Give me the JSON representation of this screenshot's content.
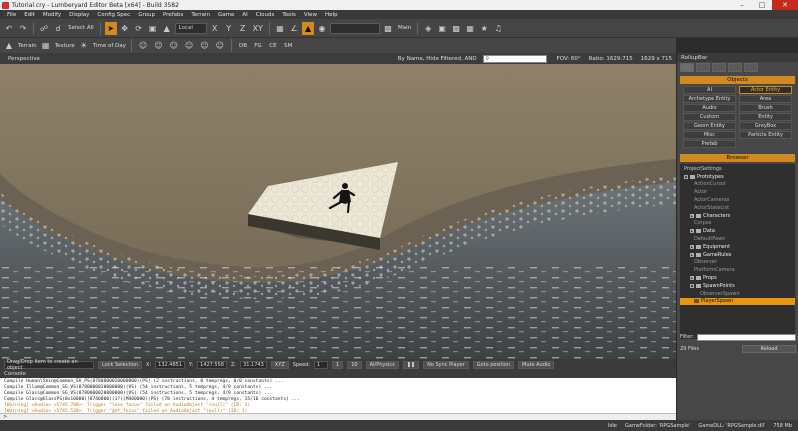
{
  "title": "Tutorial.cry - Lumberyard Editor Beta [x64] - Build 3582",
  "menu": [
    "File",
    "Edit",
    "Modify",
    "Display",
    "Config Spec",
    "Group",
    "Prefabs",
    "Terrain",
    "Game",
    "AI",
    "Clouds",
    "Tools",
    "View",
    "Help"
  ],
  "toolbar": {
    "select_all": "Select All",
    "coord_system": "Local",
    "axes": [
      "X",
      "Y",
      "Z",
      "XY"
    ],
    "main_label": "Main"
  },
  "toolbar2": {
    "terrain": "Terrain",
    "texture": "Texture",
    "time_of_day": "Time of Day",
    "codes": [
      "DB",
      "FG",
      "CE",
      "SM"
    ]
  },
  "viewport": {
    "name": "Perspective",
    "filter": "By Name, Hide Filtered, AND",
    "fov_label": "FOV:",
    "fov": "60°",
    "ratio_label": "Ratio:",
    "ratio": "1629:715",
    "resolution": "1629 x 715"
  },
  "statusbar": {
    "hint": "Drag/Drop item to create an object",
    "lock_selection": "Lock Selection",
    "x_label": "X:",
    "x": "132.4851",
    "y_label": "Y:",
    "y": "1427.558",
    "z_label": "Z:",
    "z": "31.1743",
    "xyz_label": "XYZ",
    "speed_label": "Speed:",
    "speed": "1",
    "speed_steps": [
      "1",
      "10"
    ],
    "ai_physics": "AI/Physics",
    "no_sync_player": "No Sync Player",
    "goto_position": "Goto position",
    "mute_audio": "Mute Audio"
  },
  "console": {
    "title": "Console",
    "lines": [
      {
        "text": "Compile Human\\Skin@Common_SV_PS(8780000020000000)(PS) (2 instructions, 0 tempregs, 0/0 constants) ...",
        "warn": false
      },
      {
        "text": "Compile Illum@Common_SG_VS(8780000020000000)(VS) (54 instructions, 5 tempregs, 4/9 constants) ...",
        "warn": false
      },
      {
        "text": "Compile Glass@Common_SG_VS(8780000020000000)(VS) (54 instructions, 5 tempregs, 4/9 constants) ...",
        "warn": false
      },
      {
        "text": "Compile Glass@GlassPS(0x10000)(8740000)(1?)(M400000)(PS) (78 instructions, 4 tempregs, 15/16 constants) ...",
        "warn": false
      },
      {
        "text": "[Warning] <Audio> <5745.700>: Trigger \"lose_focus\" failed on AudioObject \"(null)\" (ID: 1)",
        "warn": true
      },
      {
        "text": "[Warning] <Audio> <5745.530>: Trigger \"get_focus\" failed on AudioObject \"(null)\" (ID: 1)",
        "warn": true
      }
    ],
    "prompt": ">"
  },
  "bottom_status": {
    "idle": "Idle",
    "game_folder": "GameFolder: 'RPGSample'",
    "game_dll": "GameDLL: 'RPGSample.dll'",
    "memory": "758 Mb"
  },
  "rollup": {
    "title": "RollupBar",
    "objects_title": "Objects",
    "objects": [
      "AI",
      "Actor Entity",
      "Archetype Entity",
      "Area",
      "Audio",
      "Brush",
      "Custom",
      "Entity",
      "Geom Entity",
      "GreyBox",
      "Misc",
      "Particle Entity",
      "Prefab"
    ],
    "objects_selected": "Actor Entity",
    "browser_title": "Browser",
    "tree": [
      {
        "label": "ProjectSettings",
        "level": 0,
        "kind": "item"
      },
      {
        "label": "Prototypes",
        "level": 0,
        "kind": "folder-open"
      },
      {
        "label": "ActionCursor",
        "level": 1,
        "kind": "item"
      },
      {
        "label": "Actor",
        "level": 1,
        "kind": "item"
      },
      {
        "label": "ActorCameras",
        "level": 1,
        "kind": "item"
      },
      {
        "label": "ActorStateList",
        "level": 1,
        "kind": "item"
      },
      {
        "label": "Characters",
        "level": 1,
        "kind": "folder"
      },
      {
        "label": "Corpse",
        "level": 1,
        "kind": "item"
      },
      {
        "label": "Data",
        "level": 1,
        "kind": "folder"
      },
      {
        "label": "DefaultPawn",
        "level": 1,
        "kind": "item"
      },
      {
        "label": "Equipment",
        "level": 1,
        "kind": "folder"
      },
      {
        "label": "GameRules",
        "level": 1,
        "kind": "folder"
      },
      {
        "label": "Observer",
        "level": 1,
        "kind": "item"
      },
      {
        "label": "PlatformCamera",
        "level": 1,
        "kind": "item"
      },
      {
        "label": "Props",
        "level": 1,
        "kind": "folder"
      },
      {
        "label": "SpawnPoints",
        "level": 1,
        "kind": "folder-open"
      },
      {
        "label": "ObserverSpawn",
        "level": 2,
        "kind": "item"
      },
      {
        "label": "PlayerSpawn",
        "level": 2,
        "kind": "selected"
      }
    ],
    "filter_label": "Filter:",
    "files_count": "29 Files",
    "reload": "Reload"
  }
}
